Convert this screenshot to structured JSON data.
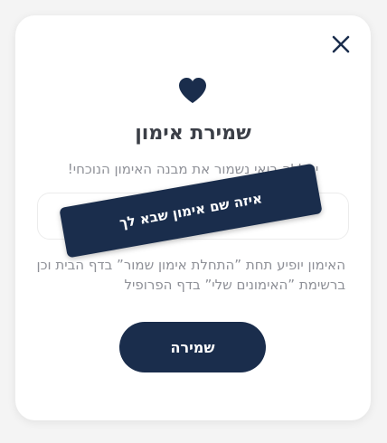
{
  "modal": {
    "close_icon": "close-icon",
    "heart_icon": "heart-icon",
    "title": "שמירת אימון",
    "subtitle": "יאללה בואי נשמור את מבנה האימון הנוכחי!",
    "name_input": {
      "placeholder": "איזה שם אימון שבא לך",
      "value": ""
    },
    "description": "האימון יופיע תחת ”התחלת אימון שמור” בדף הבית וכן ברשימת ”האימונים שלי” בדף הפרופיל",
    "save_button_label": "שמירה"
  },
  "colors": {
    "primary": "#1a2d4c",
    "title": "#3b3f47",
    "muted_text": "#8e9097",
    "card": "#ffffff",
    "backdrop": "#f4f4f4"
  }
}
